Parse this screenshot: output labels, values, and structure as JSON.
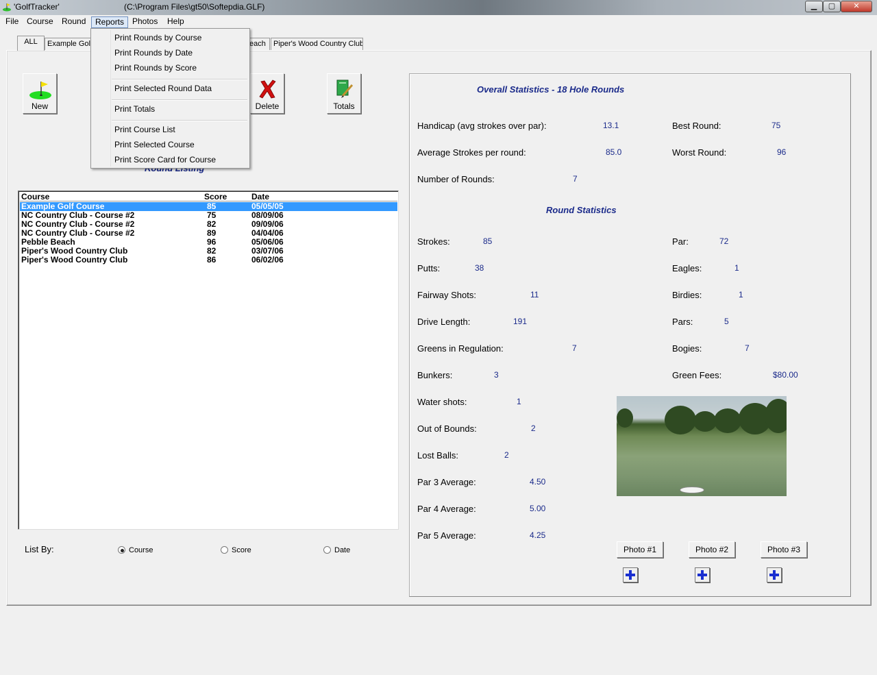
{
  "titlebar": {
    "title": "'GolfTracker'",
    "path": "(C:\\Program Files\\gt50\\Softepdia.GLF)",
    "minimize": "▁",
    "maximize": "▢",
    "close": "✕"
  },
  "menubar": {
    "items": [
      "File",
      "Course",
      "Round",
      "Reports",
      "Photos",
      "Help"
    ],
    "active": "Reports"
  },
  "reports_menu": {
    "items": [
      "Print Rounds by Course",
      "Print Rounds by Date",
      "Print Rounds by Score",
      "Print Selected Round Data",
      "Print Totals",
      "Print Course List",
      "Print Selected Course",
      "Print Score Card for Course"
    ]
  },
  "tabs": [
    "ALL",
    "Example Golf",
    "each",
    "Piper's Wood Country Club"
  ],
  "toolbar": {
    "new_label": "New",
    "delete_label": "Delete",
    "totals_label": "Totals"
  },
  "listing": {
    "heading": "Round Listing",
    "columns": [
      "Course",
      "Score",
      "Date"
    ],
    "rows": [
      {
        "course": "Example Golf Course",
        "score": "85",
        "date": "05/05/05"
      },
      {
        "course": "NC Country Club - Course #2",
        "score": "75",
        "date": "08/09/06"
      },
      {
        "course": "NC Country Club - Course #2",
        "score": "82",
        "date": "09/09/06"
      },
      {
        "course": "NC Country Club - Course #2",
        "score": "89",
        "date": "04/04/06"
      },
      {
        "course": "Pebble Beach",
        "score": "96",
        "date": "05/06/06"
      },
      {
        "course": "Piper's Wood Country Club",
        "score": "82",
        "date": "03/07/06"
      },
      {
        "course": "Piper's Wood Country Club",
        "score": "86",
        "date": "06/02/06"
      }
    ],
    "selected_index": 0
  },
  "list_by": {
    "label": "List By:",
    "options": [
      "Course",
      "Score",
      "Date"
    ],
    "selected": "Course"
  },
  "overall": {
    "heading": "Overall Statistics - 18 Hole Rounds",
    "handicap_label": "Handicap (avg strokes over par):",
    "handicap": "13.1",
    "best_label": "Best Round:",
    "best": "75",
    "avg_label": "Average Strokes per round:",
    "avg": "85.0",
    "worst_label": "Worst Round:",
    "worst": "96",
    "rounds_label": "Number of Rounds:",
    "rounds": "7"
  },
  "round": {
    "heading": "Round Statistics",
    "left": [
      {
        "label": "Strokes:",
        "value": "85"
      },
      {
        "label": "Putts:",
        "value": "38"
      },
      {
        "label": "Fairway Shots:",
        "value": "11"
      },
      {
        "label": "Drive Length:",
        "value": "191"
      },
      {
        "label": "Greens in Regulation:",
        "value": "7"
      },
      {
        "label": "Bunkers:",
        "value": "3"
      },
      {
        "label": "Water shots:",
        "value": "1"
      },
      {
        "label": "Out of Bounds:",
        "value": "2"
      },
      {
        "label": "Lost Balls:",
        "value": "2"
      },
      {
        "label": "Par 3 Average:",
        "value": "4.50"
      },
      {
        "label": "Par 4 Average:",
        "value": "5.00"
      },
      {
        "label": "Par 5 Average:",
        "value": "4.25"
      }
    ],
    "right": [
      {
        "label": "Par:",
        "value": "72"
      },
      {
        "label": "Eagles:",
        "value": "1"
      },
      {
        "label": "Birdies:",
        "value": "1"
      },
      {
        "label": "Pars:",
        "value": "5"
      },
      {
        "label": "Bogies:",
        "value": "7"
      },
      {
        "label": "Green Fees:",
        "value": "$80.00"
      }
    ]
  },
  "photos": {
    "buttons": [
      "Photo #1",
      "Photo #2",
      "Photo #3"
    ]
  },
  "colors": {
    "accent_text": "#1a2a8a",
    "selection": "#3399ff",
    "plus_icon": "#1a2fd0"
  }
}
